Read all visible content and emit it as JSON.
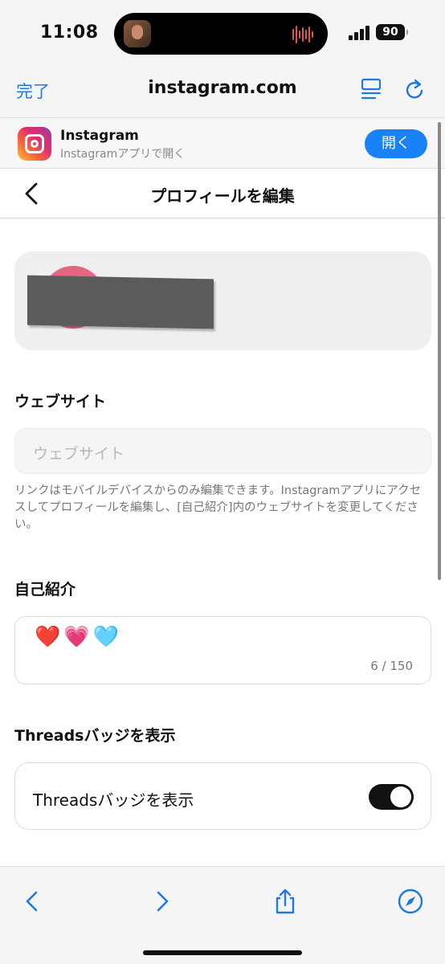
{
  "status_bar": {
    "time": "11:08",
    "battery": "90",
    "battery_icon": "battery-icon",
    "signal_icon": "cellular-signal-icon"
  },
  "browser": {
    "done_label": "完了",
    "url": "instagram.com",
    "reader_icon": "reader-list-icon",
    "reload_icon": "reload-icon",
    "accent_color": "#1f7ae0"
  },
  "app_banner": {
    "title": "Instagram",
    "subtitle": "Instagramアプリで開く",
    "open_label": "開く",
    "button_color": "#1a82f7"
  },
  "page": {
    "title": "プロフィールを編集",
    "back_icon": "chevron-left-icon"
  },
  "website": {
    "label": "ウェブサイト",
    "placeholder": "ウェブサイト",
    "help": "リンクはモバイルデバイスからのみ編集できます。Instagramアプリにアクセスしてプロフィールを編集し、[自己紹介]内のウェブサイトを変更してください。"
  },
  "bio": {
    "label": "自己紹介",
    "value": "❤️💗🩵",
    "count": "6 / 150"
  },
  "threads": {
    "section_label": "Threadsバッジを表示",
    "toggle_label": "Threadsバッジを表示",
    "toggle_on": true
  },
  "toolbar": {
    "icons": [
      "back-arrow-icon",
      "forward-arrow-icon",
      "share-icon",
      "compass-icon"
    ]
  }
}
